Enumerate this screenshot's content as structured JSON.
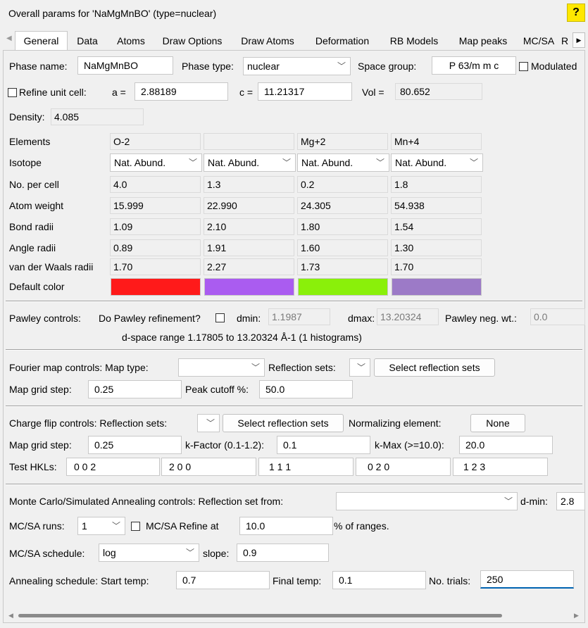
{
  "title": "Overall params for 'NaMgMnBO' (type=nuclear)",
  "help_label": "?",
  "tabs": [
    "General",
    "Data",
    "Atoms",
    "Draw Options",
    "Draw Atoms",
    "Deformation",
    "RB Models",
    "Map peaks",
    "MC/SA",
    "R"
  ],
  "active_tab": "General",
  "phase": {
    "name_label": "Phase name:",
    "name_value": "NaMgMnBO",
    "type_label": "Phase type:",
    "type_value": "nuclear",
    "spacegroup_label": "Space group:",
    "spacegroup_value": "P 63/m m c",
    "modulated_label": "Modulated"
  },
  "cell": {
    "refine_label": "Refine unit cell:",
    "a_label": "a =",
    "a_value": "2.88189",
    "c_label": "c =",
    "c_value": "11.21317",
    "vol_label": "Vol =",
    "vol_value": "80.652"
  },
  "density": {
    "label": "Density:",
    "value": "4.085"
  },
  "element_table": {
    "row_labels": [
      "Elements",
      "Isotope",
      "No. per cell",
      "Atom weight",
      "Bond radii",
      "Angle radii",
      "van der Waals radii",
      "Default color"
    ],
    "columns": [
      {
        "element": "O-2",
        "isotope": "Nat. Abund.",
        "per_cell": "4.0",
        "weight": "15.999",
        "bond": "1.09",
        "angle": "0.89",
        "vdw": "1.70",
        "color": "#ff1a1a"
      },
      {
        "element": "",
        "isotope": "Nat. Abund.",
        "per_cell": "1.3",
        "weight": "22.990",
        "bond": "2.10",
        "angle": "1.91",
        "vdw": "2.27",
        "color": "#aa5cf0"
      },
      {
        "element": "Mg+2",
        "isotope": "Nat. Abund.",
        "per_cell": "0.2",
        "weight": "24.305",
        "bond": "1.80",
        "angle": "1.60",
        "vdw": "1.73",
        "color": "#8af00a"
      },
      {
        "element": "Mn+4",
        "isotope": "Nat. Abund.",
        "per_cell": "1.8",
        "weight": "54.938",
        "bond": "1.54",
        "angle": "1.30",
        "vdw": "1.70",
        "color": "#9c7ac7"
      }
    ]
  },
  "pawley": {
    "controls_label": "Pawley controls:",
    "refine_label": "Do Pawley refinement?",
    "dmin_label": "dmin:",
    "dmin_value": "1.1987",
    "dmax_label": "dmax:",
    "dmax_value": "13.20324",
    "negwt_label": "Pawley neg. wt.:",
    "negwt_value": "0.0",
    "range_text": "d-space range 1.17805 to 13.20324 Å-1 (1 histograms)"
  },
  "fourier": {
    "controls_label": "Fourier map controls: Map type:",
    "map_type_value": "",
    "refl_sets_label": "Reflection sets:",
    "select_button": "Select reflection sets",
    "grid_label": "Map grid step:",
    "grid_value": "0.25",
    "cutoff_label": "Peak cutoff %:",
    "cutoff_value": "50.0"
  },
  "charge_flip": {
    "controls_label": "Charge flip controls: Reflection sets:",
    "select_button": "Select reflection sets",
    "norm_label": "Normalizing element:",
    "norm_button": "None",
    "grid_label": "Map grid step:",
    "grid_value": "0.25",
    "kfactor_label": "k-Factor (0.1-1.2):",
    "kfactor_value": "0.1",
    "kmax_label": "k-Max (>=10.0):",
    "kmax_value": "20.0",
    "hkl_label": "Test HKLs:",
    "hkls": [
      "0  0  2",
      "2  0  0",
      "1  1  1",
      "0  2  0",
      "1  2  3"
    ]
  },
  "mcsa": {
    "controls_label": "Monte Carlo/Simulated Annealing controls: Reflection set from:",
    "refl_set_value": "",
    "dmin_label": "d-min:",
    "dmin_value": "2.8",
    "runs_label": "MC/SA runs:",
    "runs_value": "1",
    "refine_label": "MC/SA Refine at",
    "refine_value": "10.0",
    "ranges_label": "% of ranges.",
    "schedule_label": "MC/SA schedule:",
    "schedule_value": "log",
    "slope_label": "slope:",
    "slope_value": "0.9",
    "annealing_label": "Annealing schedule:  Start temp:",
    "start_temp_value": "0.7",
    "final_temp_label": "Final temp:",
    "final_temp_value": "0.1",
    "trials_label": "No. trials:",
    "trials_value": "250"
  }
}
